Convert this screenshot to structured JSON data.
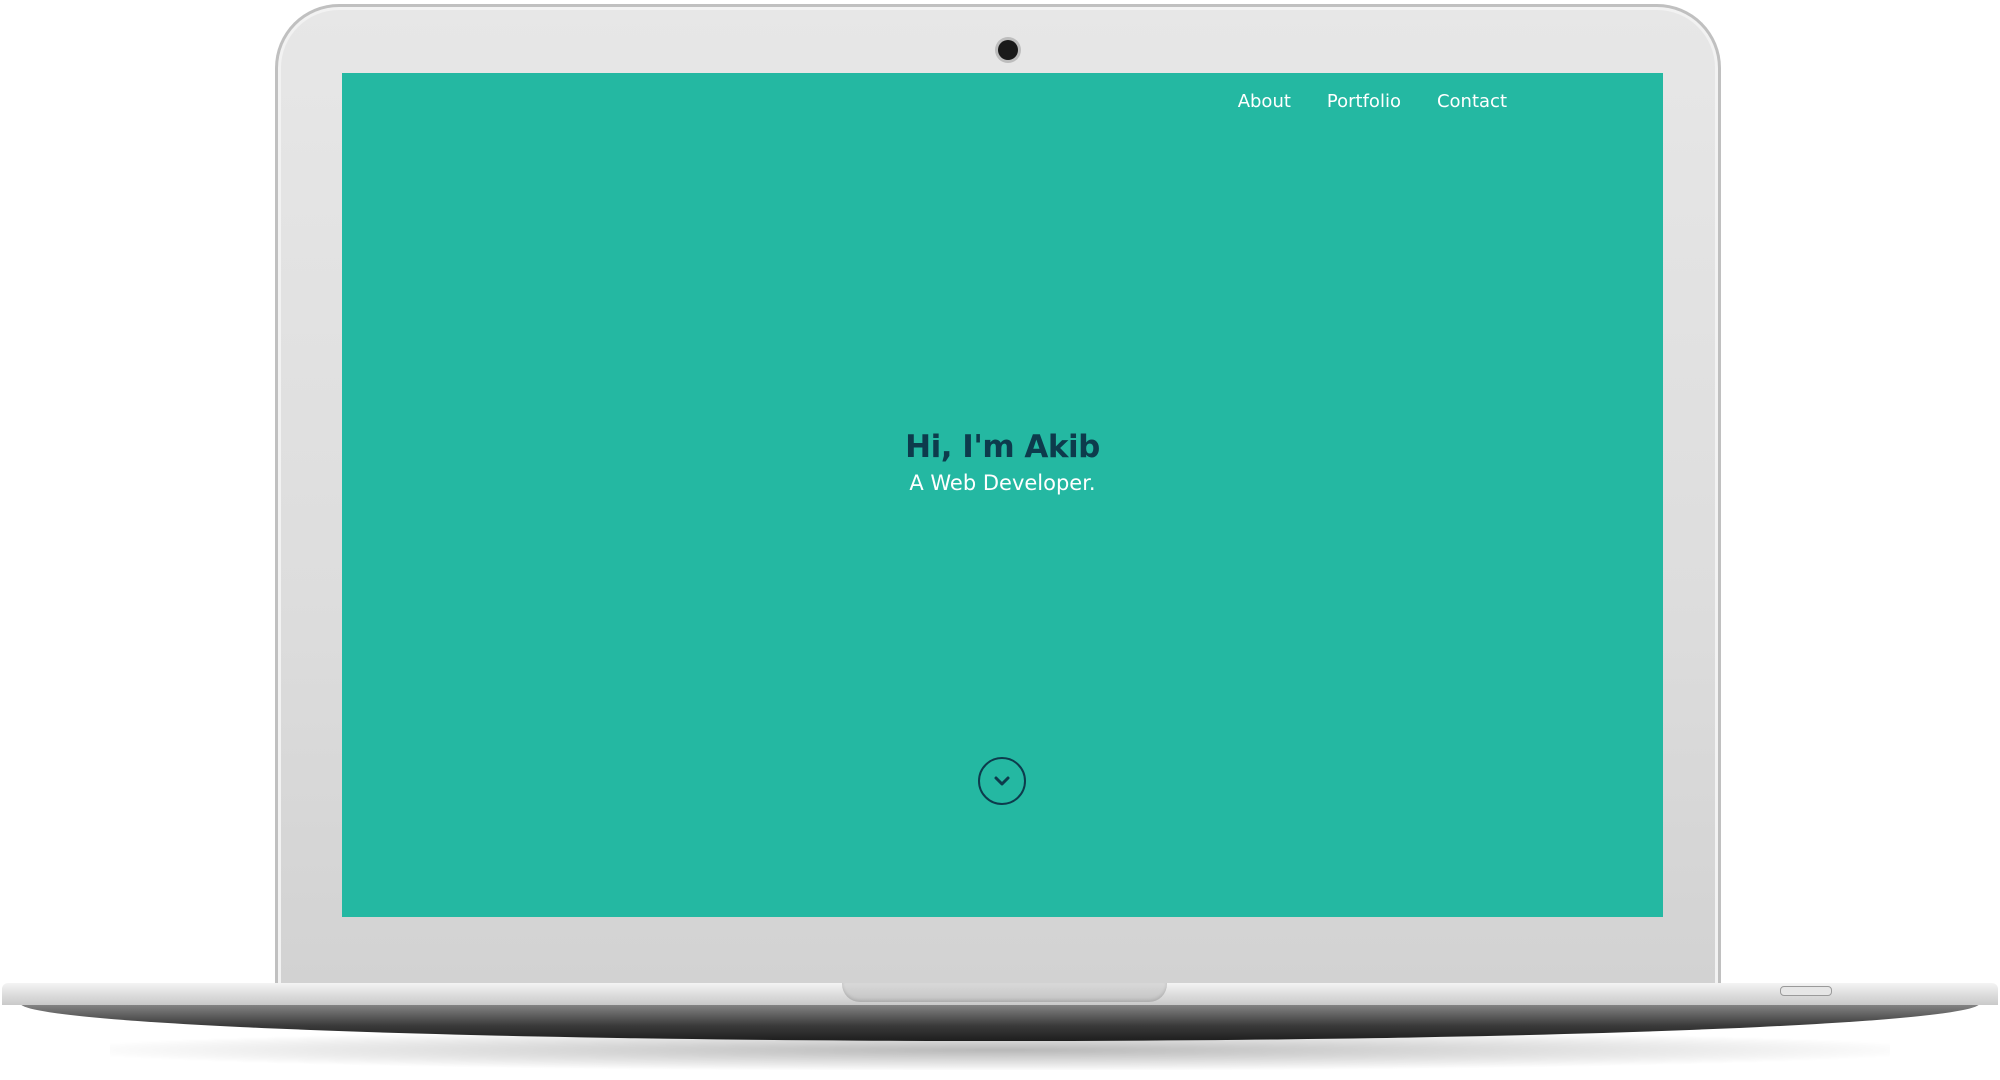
{
  "colors": {
    "screen_bg": "#24b8a2",
    "nav_text": "#ffffff",
    "title_text": "#0d3b4c",
    "subtitle_text": "#ffffff",
    "scroll_icon": "#0d3b4c"
  },
  "nav": {
    "items": [
      {
        "label": "About"
      },
      {
        "label": "Portfolio"
      },
      {
        "label": "Contact"
      }
    ]
  },
  "hero": {
    "title": "Hi, I'm Akib",
    "subtitle": "A Web Developer."
  },
  "scroll_button": {
    "icon": "chevron-down-icon"
  }
}
